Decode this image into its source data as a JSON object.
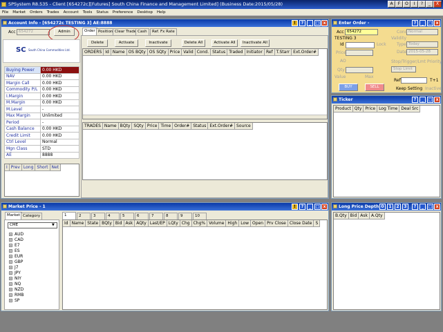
{
  "app": {
    "title": "SPSystem R8.535 - Client [654272c][Futures] South China Finance and Management Limited] (Business Date:2015/05/28)",
    "title_buttons": [
      "A",
      "F",
      "O",
      "I",
      "?",
      "_",
      "□",
      "X"
    ]
  },
  "menu": [
    "File",
    "Market",
    "Orders",
    "Trades",
    "Account",
    "Tools",
    "Status",
    "Preference",
    "Desktop",
    "Help"
  ],
  "account_info": {
    "title": "Account Info - [654272c TESTING 3] AE:8888",
    "acc_label": "Acc",
    "acc_value": "654272",
    "admin_label": "Admin",
    "logo_text": "SC",
    "logo_sub": "South China Commodities Ltd.",
    "fields": [
      {
        "k": "Buying Power",
        "v": "0.00 HKD",
        "hl": true
      },
      {
        "k": "NAV",
        "v": "0.00 HKD"
      },
      {
        "k": "Margin Call",
        "v": "0.00 HKD"
      },
      {
        "k": "Commodity P/L",
        "v": "0.00 HKD"
      },
      {
        "k": "I.Margin",
        "v": "0.00 HKD"
      },
      {
        "k": "M.Margin",
        "v": "0.00 HKD"
      },
      {
        "k": "M.Level",
        "v": "-"
      },
      {
        "k": "Max Margin",
        "v": "Unlimited"
      },
      {
        "k": "Period",
        "v": "-"
      },
      {
        "k": "Cash Balance",
        "v": "0.00 HKD"
      },
      {
        "k": "Credit Limit",
        "v": "0.00 HKD"
      },
      {
        "k": "Ctrl Level",
        "v": "Normal"
      },
      {
        "k": "Mgn Class",
        "v": "STD"
      },
      {
        "k": "AE",
        "v": "8888"
      }
    ],
    "pos_headers": [
      "I",
      "Prev",
      "Long",
      "Short",
      "Net"
    ],
    "tabs": [
      "Order",
      "Position",
      "Clear Trade",
      "Cash",
      "Ref. Fx Rate"
    ],
    "buttons": [
      "Delete",
      "Activate",
      "Inactivate",
      "Delete All",
      "Activate All",
      "Inactivate All"
    ],
    "order_headers": [
      "ORDERS",
      "Id",
      "Name",
      "OS BQty",
      "OS SQty",
      "Price",
      "Valid",
      "Cond.",
      "Status",
      "Traded",
      "Initiator",
      "Ref",
      "T.Starr",
      "Ext.Order#"
    ],
    "trade_headers": [
      "TRADES",
      "Name",
      "BQty",
      "SQty",
      "Price",
      "Time",
      "Order#",
      "Status",
      "Ext.Order#",
      "Source"
    ]
  },
  "enter_order": {
    "title": "Enter Order -",
    "acc_label": "Acc",
    "acc_value": "654272",
    "name": "TESTING 3",
    "id_label": "Id",
    "lock_label": "Lock",
    "price_label": "Price",
    "ao_label": "AO",
    "qty_label": "Qty",
    "value_label": "Value",
    "max_label": "Max",
    "cond_label": "Cond",
    "cond_value": "Normal",
    "validity_label": "Validity",
    "type_label": "Type",
    "type_value": "Today",
    "date_label": "Date",
    "date_value": "2015-05-28",
    "stop_label": "Stop/Trigger/Lmt",
    "priority_label": "Priority",
    "stop_value": "Stop Limit",
    "ref_label": "Ref",
    "t1_label": "T+1",
    "keep_label": "Keep Setting",
    "inactive_label": "Inactive",
    "buy_label": "BUY",
    "sell_label": "SELL"
  },
  "ticker": {
    "title": "Ticker",
    "headers": [
      "Product",
      "Qty",
      "Price",
      "Log Time",
      "Deal Src"
    ]
  },
  "market_price": {
    "title": "Market Price - 1",
    "side_tabs": [
      "Market",
      "Category"
    ],
    "market_select": "CME",
    "tree": [
      "AUD",
      "CAD",
      "E7",
      "ES",
      "EUR",
      "GBP",
      "J7",
      "JPY",
      "NIY",
      "NQ",
      "NZD",
      "RMB",
      "SP"
    ],
    "page_tabs": [
      "1",
      "2",
      "3",
      "4",
      "5",
      "6",
      "7",
      "8",
      "9",
      "10"
    ],
    "headers": [
      "Id",
      "Name",
      "State",
      "BQty",
      "Bid",
      "Ask",
      "AQty",
      "Last/EP",
      "LQty",
      "Chg",
      "Chg%",
      "Volume",
      "High",
      "Low",
      "Open",
      "Prv Close",
      "Close Date",
      "S"
    ]
  },
  "long_price": {
    "title": "Long Price Depth",
    "page_buttons": [
      "0",
      "1",
      "2",
      "3"
    ],
    "headers": [
      "B.Qty",
      "Bid",
      "Ask",
      "A.Qty"
    ]
  }
}
